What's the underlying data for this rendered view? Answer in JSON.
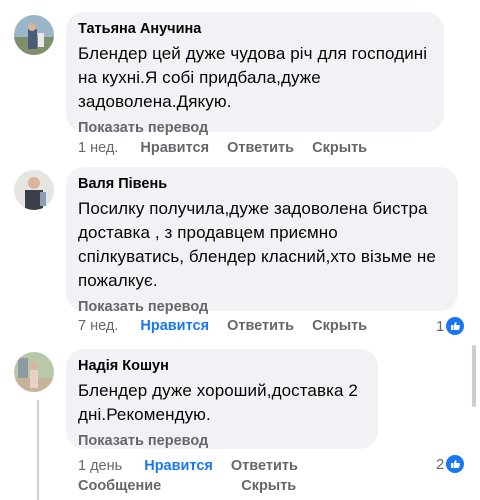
{
  "comments": [
    {
      "author": "Татьяна Анучина",
      "text": "Блендер цей дуже чудова річ для господині на кухні.Я собі придбала,дуже задоволена.Дякую.",
      "translate": "Показать перевод",
      "time": "1 нед.",
      "like": "Нравится",
      "reply": "Ответить",
      "hide": "Скрыть",
      "reactions": ""
    },
    {
      "author": "Валя Півень",
      "text": "Посилку получила,дуже задоволена бистра доставка , з продавцем приємно спілкуватись, блендер класний,хто візьме не пожалкує.",
      "translate": "Показать перевод",
      "time": "7 нед.",
      "like": "Нравится",
      "reply": "Ответить",
      "hide": "Скрыть",
      "reactions": "1"
    },
    {
      "author": "Надія Кошун",
      "text": "Блендер дуже хороший,доставка 2 дні.Рекомендую.",
      "translate": "Показать перевод",
      "time": "1 день",
      "like": "Нравится",
      "reply": "Ответить",
      "message": "Сообщение",
      "hide": "Скрыть",
      "reactions": "2"
    }
  ],
  "colors": {
    "bubble": "#f0f2f5",
    "link_blue": "#1877f2",
    "meta_gray": "#65676b"
  },
  "icons": {
    "like": "thumbs-up-icon"
  }
}
